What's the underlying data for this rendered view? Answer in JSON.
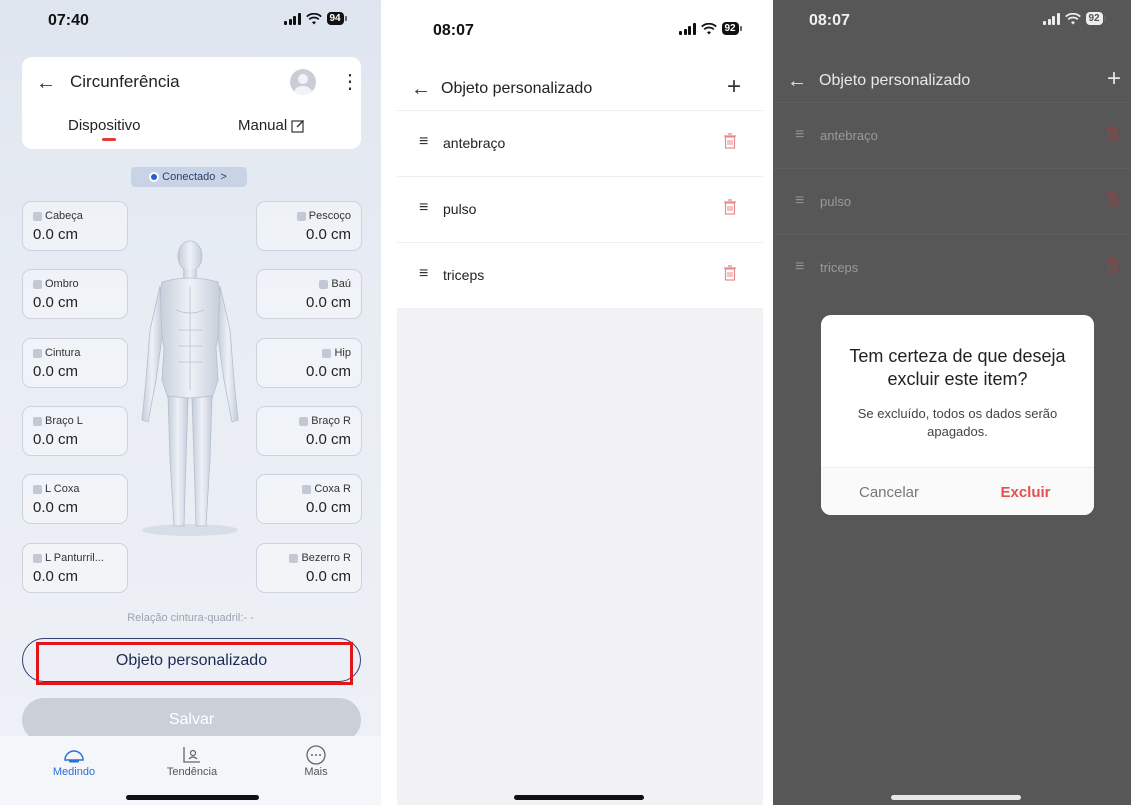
{
  "screen1": {
    "status": {
      "time": "07:40",
      "battery": "94"
    },
    "header": {
      "title": "Circunferência"
    },
    "tabs": {
      "device": "Dispositivo",
      "manual": "Manual"
    },
    "connection": "Conectado",
    "measurements_left": [
      {
        "label": "Cabeça",
        "value": "0.0 cm"
      },
      {
        "label": "Ombro",
        "value": "0.0 cm"
      },
      {
        "label": "Cintura",
        "value": "0.0 cm"
      },
      {
        "label": "Braço L",
        "value": "0.0 cm"
      },
      {
        "label": "L Coxa",
        "value": "0.0 cm"
      },
      {
        "label": "L Panturril...",
        "value": "0.0 cm"
      }
    ],
    "measurements_right": [
      {
        "label": "Pescoço",
        "value": "0.0 cm"
      },
      {
        "label": "Baú",
        "value": "0.0 cm"
      },
      {
        "label": "Hip",
        "value": "0.0 cm"
      },
      {
        "label": "Braço R",
        "value": "0.0 cm"
      },
      {
        "label": "Coxa R",
        "value": "0.0 cm"
      },
      {
        "label": "Bezerro R",
        "value": "0.0 cm"
      }
    ],
    "ratio_label": "Relação cintura-quadril:- -",
    "custom_button": "Objeto personalizado",
    "save_button": "Salvar",
    "tabbar": [
      {
        "label": "Medindo"
      },
      {
        "label": "Tendência"
      },
      {
        "label": "Mais"
      }
    ]
  },
  "screen2": {
    "status": {
      "time": "08:07",
      "battery": "92"
    },
    "header": {
      "title": "Objeto personalizado"
    },
    "items": [
      {
        "name": "antebraço"
      },
      {
        "name": "pulso"
      },
      {
        "name": "triceps"
      }
    ]
  },
  "screen3": {
    "status": {
      "time": "08:07",
      "battery": "92"
    },
    "header": {
      "title": "Objeto personalizado"
    },
    "items": [
      {
        "name": "antebraço"
      },
      {
        "name": "pulso"
      },
      {
        "name": "triceps"
      }
    ],
    "dialog": {
      "title": "Tem certeza de que deseja excluir este item?",
      "message": "Se excluído, todos os dados serão apagados.",
      "cancel": "Cancelar",
      "confirm": "Excluir"
    }
  },
  "colors": {
    "accent_red": "#e53935",
    "active_blue": "#2b6fd8",
    "navy": "#1d2a54",
    "delete_red": "#e55050"
  }
}
